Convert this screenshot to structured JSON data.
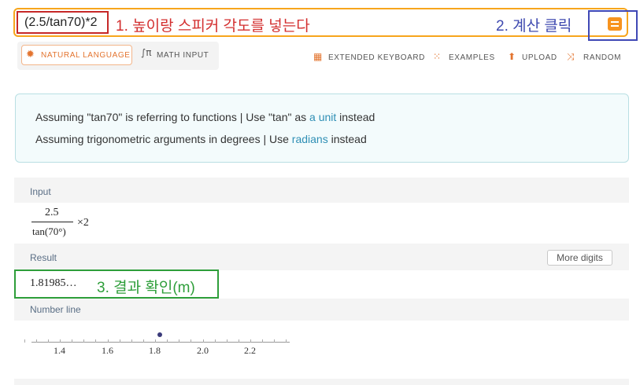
{
  "search": {
    "query": "(2.5/tan70)*2"
  },
  "annotations": {
    "step1": "1. 높이랑 스피커 각도를 넣는다",
    "step2": "2. 계산 클릭",
    "step3": "3. 결과 확인(m)"
  },
  "input_modes": {
    "natural_language": "NATURAL LANGUAGE",
    "math_input": "MATH INPUT",
    "selected": "natural_language"
  },
  "toolbar": {
    "extended_keyboard": "EXTENDED KEYBOARD",
    "examples": "EXAMPLES",
    "upload": "UPLOAD",
    "random": "RANDOM"
  },
  "assumptions": {
    "line1_prefix": "Assuming \"tan70\" is referring to functions | Use \"tan\" as ",
    "line1_link": "a unit",
    "line1_suffix": " instead",
    "line2_prefix": "Assuming trigonometric arguments in degrees | Use ",
    "line2_link": "radians",
    "line2_suffix": " instead"
  },
  "pods": {
    "input": {
      "title": "Input",
      "numerator": "2.5",
      "denominator": "tan(70°)",
      "multiplier": "×2"
    },
    "result": {
      "title": "Result",
      "value": "1.81985…",
      "more_digits": "More digits"
    },
    "number_line": {
      "title": "Number line",
      "tick_labels": [
        "1.4",
        "1.6",
        "1.8",
        "2.0",
        "2.2"
      ],
      "point_value": 1.81985
    }
  },
  "colors": {
    "accent_orange": "#f7931e",
    "annotation_red": "#d32f2f",
    "annotation_blue": "#3f48b5",
    "annotation_green": "#2e9e3a",
    "link_blue": "#2f8fb5"
  }
}
